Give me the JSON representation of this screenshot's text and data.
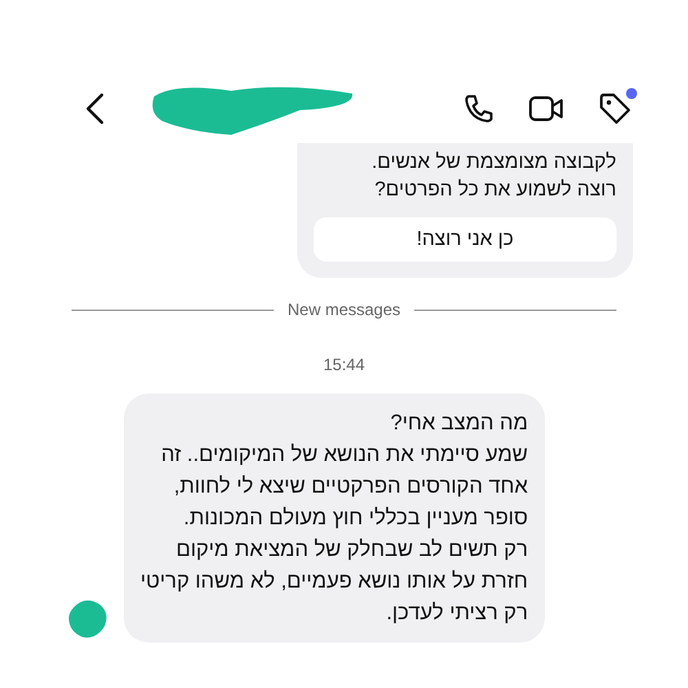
{
  "header": {
    "tag_notification": true
  },
  "messages": [
    {
      "kind": "outgoing_card",
      "lines": [
        "לקבוצה מצומצמת של אנשים.",
        "רוצה לשמוע את כל הפרטים?"
      ],
      "button": "כן אני רוצה!"
    },
    {
      "kind": "divider",
      "label": "New messages"
    },
    {
      "kind": "time",
      "label": "15:44"
    },
    {
      "kind": "incoming",
      "lines": [
        "מה המצב אחי?",
        "שמע סיימתי את הנושא של המיקומים.. זה",
        "אחד הקורסים הפרקטיים שיצא לי לחוות,",
        "סופר מעניין בכללי חוץ מעולם המכונות.",
        "רק תשים לב שבחלק של המציאת מיקום",
        "חזרת על אותו נושא פעמיים, לא משהו קריטי",
        "רק רציתי לעדכן."
      ]
    }
  ]
}
